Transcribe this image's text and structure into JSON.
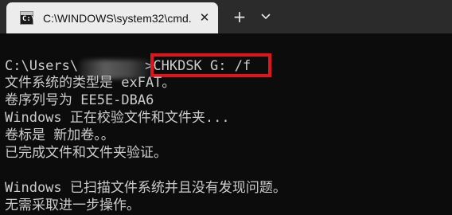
{
  "window": {
    "tab_title": "C:\\WINDOWS\\system32\\cmd.",
    "tab_close_glyph": "✕",
    "new_tab_glyph": "+",
    "dropdown_icon": "chevron-down-icon",
    "tab_icon": "cmd-icon",
    "tab_icon_prompt": "C:\\"
  },
  "terminal": {
    "prompt_prefix": "C:\\Users\\",
    "prompt_suffix": ">",
    "command": "CHKDSK G: /f",
    "lines": [
      "文件系统的类型是 exFAT。",
      "卷序列号为 EE5E-DBA6",
      "Windows 正在校验文件和文件夹...",
      "卷标是 新加卷。。",
      "已完成文件和文件夹验证。",
      "",
      "Windows 已扫描文件系统并且没有发现问题。",
      "无需采取进一步操作。"
    ]
  },
  "colors": {
    "background": "#0c0c0c",
    "text": "#cccccc",
    "titlebar": "#2b2b2b",
    "tab": "#ececec",
    "highlight_border": "#e0151c"
  }
}
